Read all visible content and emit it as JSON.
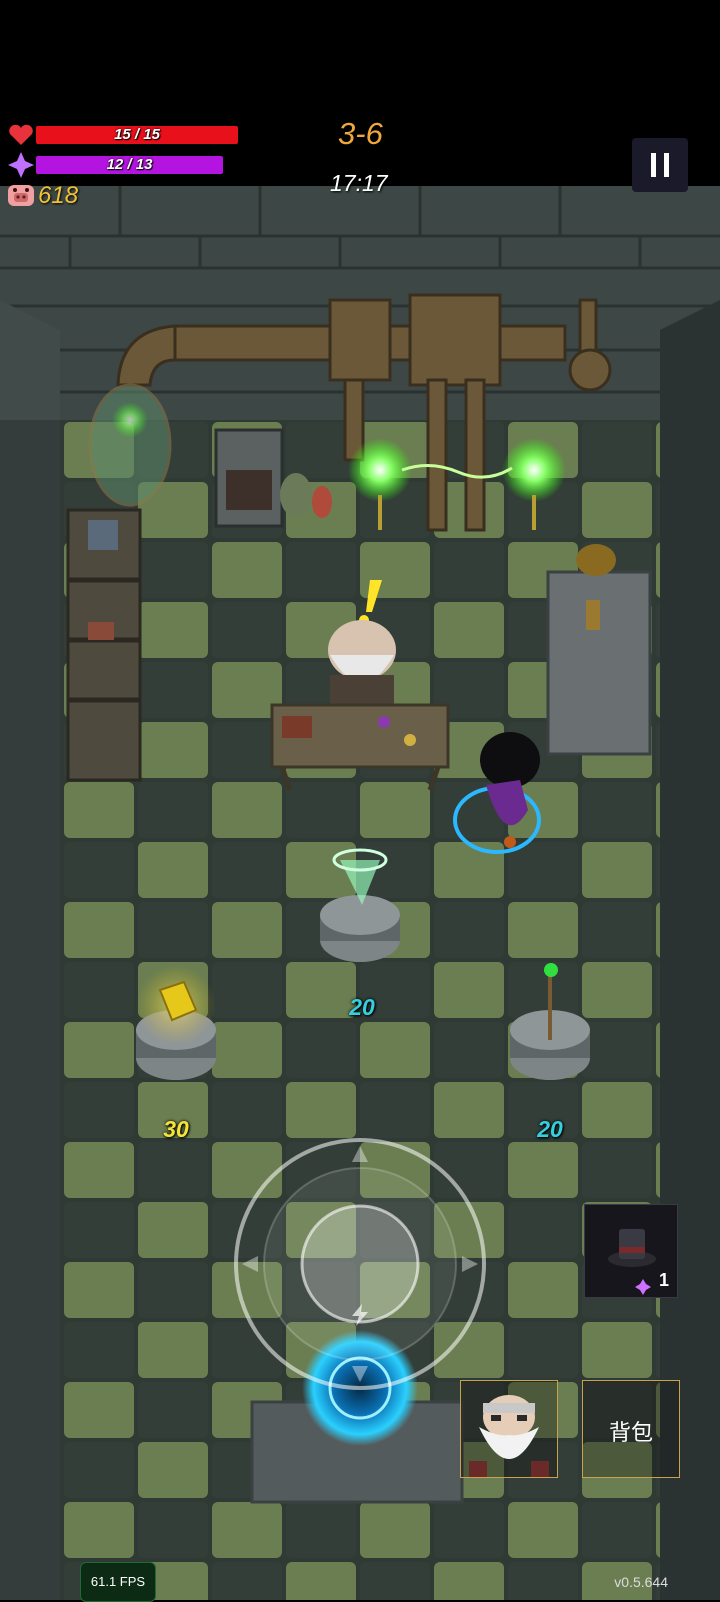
{
  "hud": {
    "hp_text": "15 / 15",
    "hp_fraction": 1.0,
    "mp_text": "12 / 13",
    "mp_fraction": 0.923,
    "gold": "618",
    "level": "3-6",
    "timer": "17:17"
  },
  "shop": {
    "items": [
      {
        "name": "tornado-spell",
        "price": "20",
        "price_color": "#35d0e0"
      },
      {
        "name": "golden-tome",
        "price": "30",
        "price_color": "#f6e33a"
      },
      {
        "name": "emerald-staff",
        "price": "20",
        "price_color": "#35d0e0"
      }
    ]
  },
  "inventory": {
    "item_icon": "top-hat-icon",
    "item_count": "1"
  },
  "buttons": {
    "backpack_label": "背包",
    "npc_portrait": "old-wizard-portrait"
  },
  "debug": {
    "fps": "61.1 FPS",
    "version": "v0.5.644"
  },
  "colors": {
    "hp": "#e8101a",
    "mp": "#b414e0",
    "gold": "#f1c232",
    "level": "#f0a83c",
    "portal": "#2ad0ff",
    "floor_light": "#6b7f52",
    "floor_dark": "#2f3a33"
  }
}
